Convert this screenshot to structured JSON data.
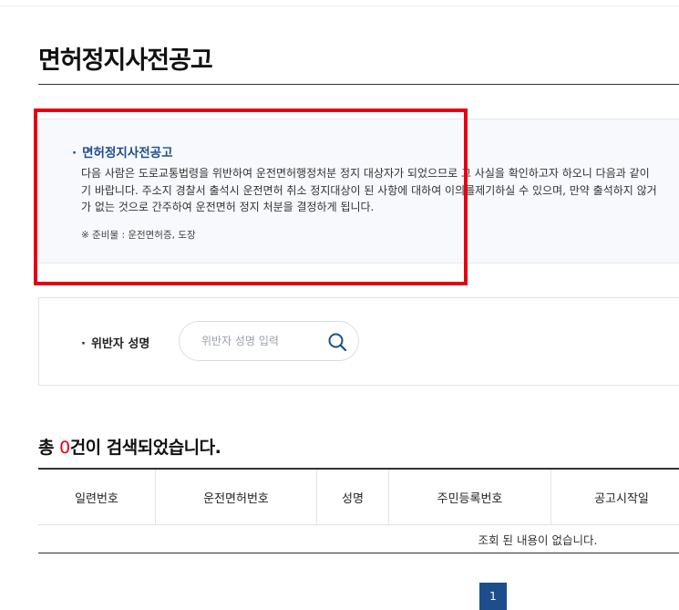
{
  "page": {
    "title": "면허정지사전공고"
  },
  "notice": {
    "bullet": "·",
    "title": "면허정지사전공고",
    "body_lines": [
      "다음 사람은 도로교통법령을 위반하여 운전면허행정처분 정지 대상자가 되었으므로 그 사실을 확인하고자 하오니 다음과 같이",
      "기 바랍니다. 주소지 경찰서 출석시 운전면허 취소 정지대상이 된 사항에 대하여 이의를제기하실 수 있으며, 만약 출석하지 않거",
      "가 없는 것으로 간주하여 운전면허 정지 처분을 결정하게 됩니다."
    ],
    "prep_items": "※ 준비물 : 운전면허증, 도장"
  },
  "search": {
    "bullet": "·",
    "label": "위반자 성명",
    "placeholder": "위반자 성명 입력",
    "value": "",
    "button_icon": "search-icon"
  },
  "results": {
    "prefix": "총 ",
    "count": "0",
    "suffix": "건이 검색되었습니다."
  },
  "table": {
    "columns": [
      "일련번호",
      "운전면허번호",
      "성명",
      "주민등록번호",
      "공고시작일"
    ],
    "rows": [],
    "empty_message": "조회 된 내용이 없습니다."
  },
  "pagination": {
    "pages": [
      "1"
    ],
    "current": "1"
  },
  "colors": {
    "accent_blue": "#1d4e8c",
    "highlight_red": "#e60012",
    "notice_bg": "#f7f9fc"
  }
}
